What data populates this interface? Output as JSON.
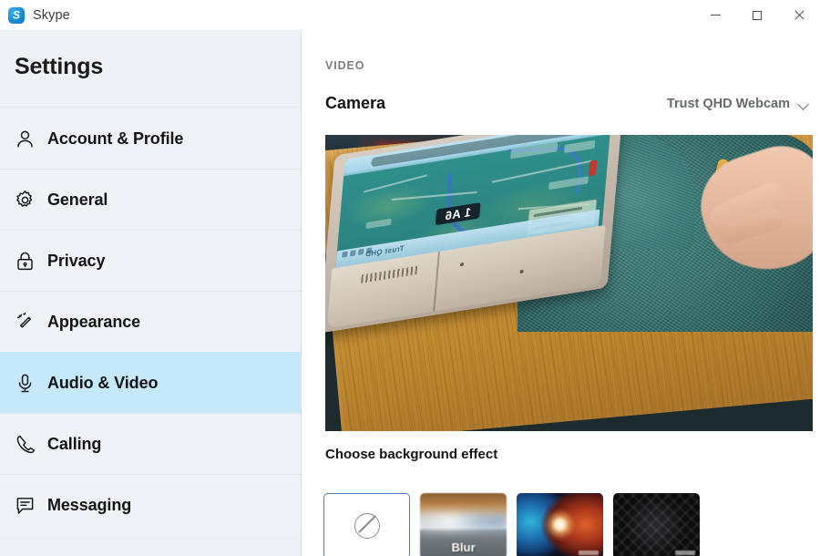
{
  "window": {
    "app_title": "Skype",
    "logo_letter": "S",
    "controls": {
      "minimize": "Minimize",
      "maximize": "Maximize",
      "close": "Close"
    }
  },
  "sidebar": {
    "heading": "Settings",
    "items": [
      {
        "label": "Account & Profile",
        "icon": "person-icon",
        "selected": false
      },
      {
        "label": "General",
        "icon": "gear-icon",
        "selected": false
      },
      {
        "label": "Privacy",
        "icon": "lock-icon",
        "selected": false
      },
      {
        "label": "Appearance",
        "icon": "magic-wand-icon",
        "selected": false
      },
      {
        "label": "Audio & Video",
        "icon": "microphone-icon",
        "selected": true
      },
      {
        "label": "Calling",
        "icon": "phone-icon",
        "selected": false
      },
      {
        "label": "Messaging",
        "icon": "chat-bubble-icon",
        "selected": false
      }
    ],
    "selected_highlight_color": "#c5e9fb",
    "background_color": "#eef1f5"
  },
  "main": {
    "section_label": "VIDEO",
    "camera": {
      "title": "Camera",
      "selected_device": "Trust QHD Webcam",
      "chevron_icon": "chevron-down-icon"
    },
    "preview": {
      "alt": "Live webcam preview: person in teal fleece at a wooden desk holding a foldable phone showing a map app",
      "map_label": "1 A6"
    },
    "background_effect": {
      "heading": "Choose background effect",
      "options": [
        {
          "name": "None",
          "caption": "",
          "icon": "no-effect-icon",
          "selected": true
        },
        {
          "name": "Blur",
          "caption": "Blur",
          "icon": "",
          "selected": false
        },
        {
          "name": "Cosmos",
          "caption": "",
          "icon": "",
          "selected": false
        },
        {
          "name": "Dark Pattern",
          "caption": "",
          "icon": "",
          "selected": false
        }
      ],
      "selection_border_color": "#4f7fb5"
    }
  }
}
